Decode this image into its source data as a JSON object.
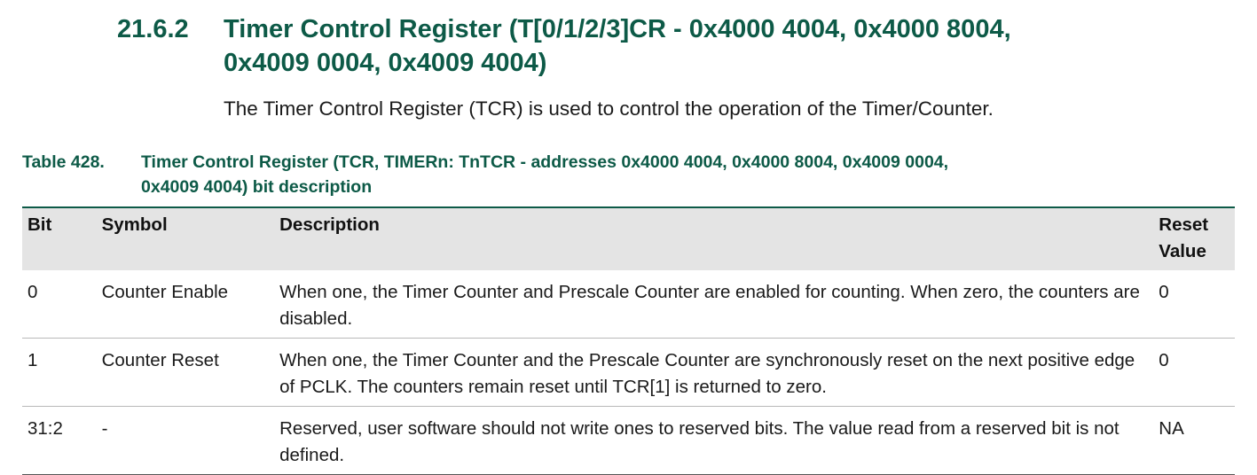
{
  "section": {
    "number": "21.6.2",
    "title_line1": "Timer Control Register (T[0/1/2/3]CR - 0x4000 4004, 0x4000 8004,",
    "title_line2": "0x4009 0004, 0x4009 4004)"
  },
  "intro": "The Timer Control Register (TCR) is used to control the operation of the Timer/Counter.",
  "table": {
    "caption_label": "Table 428.",
    "caption_line1": "Timer Control Register (TCR, TIMERn: TnTCR - addresses 0x4000 4004, 0x4000 8004, 0x4009 0004,",
    "caption_line2": "0x4009 4004) bit description",
    "headers": [
      "Bit",
      "Symbol",
      "Description",
      "Reset Value"
    ],
    "rows": [
      {
        "bit": "0",
        "symbol": "Counter Enable",
        "description": "When one, the Timer Counter and Prescale Counter are enabled for counting. When zero, the counters are disabled.",
        "reset": "0"
      },
      {
        "bit": "1",
        "symbol": "Counter Reset",
        "description": "When one, the Timer Counter and the Prescale Counter are synchronously reset on the next positive edge of PCLK. The counters remain reset until TCR[1] is returned to zero.",
        "reset": "0"
      },
      {
        "bit": "31:2",
        "symbol": "-",
        "description": "Reserved, user software should not write ones to reserved bits. The value read from a reserved bit is not defined.",
        "reset": "NA"
      }
    ]
  },
  "colors": {
    "heading": "#0d5a47",
    "header_row_bg": "#e4e4e4"
  }
}
